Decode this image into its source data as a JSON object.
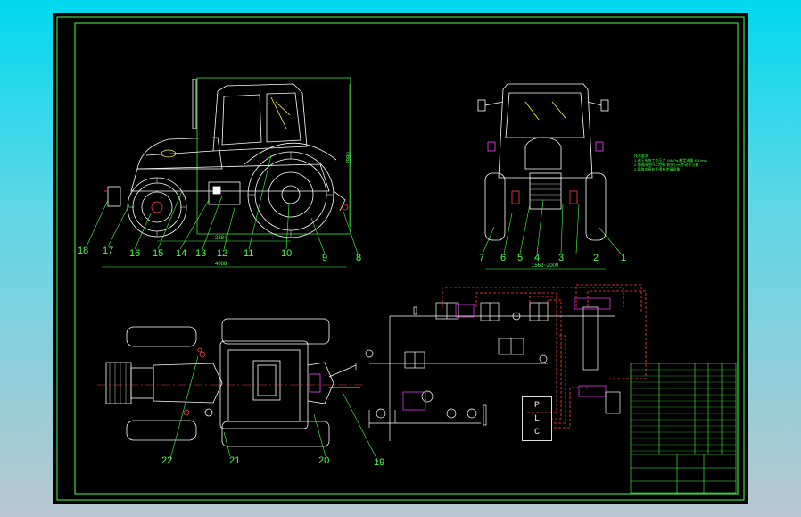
{
  "drawing": {
    "title": "",
    "side_view_callouts": [
      "18",
      "17",
      "16",
      "15",
      "14",
      "13",
      "12",
      "11",
      "10",
      "9",
      "8"
    ],
    "rear_view_callouts": [
      "7",
      "6",
      "5",
      "4",
      "3",
      "2",
      "1"
    ],
    "plan_view_callouts": [
      "22",
      "21",
      "20",
      "19"
    ],
    "plc_label": [
      "P",
      "L",
      "C"
    ],
    "dimension_texts": {
      "side_overall_length": "4088",
      "side_wheelbase": "2384",
      "side_height": "2980",
      "rear_track": "1562~2000"
    },
    "notes_title": "技术要求",
    "notes_lines": [
      "1.液压系统工作压力 16MPa,额定流量 40L/min",
      "2.电磁阀由PLC控制,各执行元件动作可靠",
      "3.管路连接处不得有泄漏现象"
    ],
    "colors": {
      "frame": "#4cff4c",
      "drawing_lines": "#ffffff",
      "dimension": "#4cff4c",
      "signal_lines": "#ff4040",
      "highlight": "#ff40ff",
      "valve_labels": "#ffff40",
      "background": "#000000"
    }
  }
}
